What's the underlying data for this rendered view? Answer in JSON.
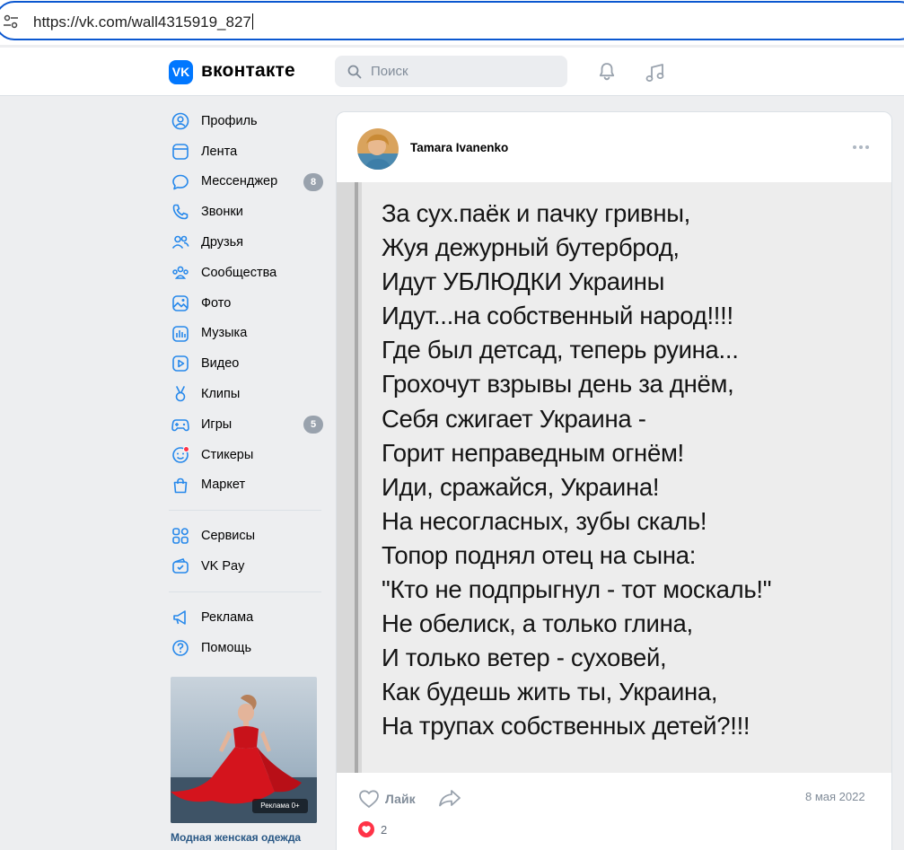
{
  "browser": {
    "url": "https://vk.com/wall4315919_827"
  },
  "header": {
    "logo_letters": "VK",
    "brand": "вконтакте",
    "search_placeholder": "Поиск"
  },
  "sidebar": {
    "items": [
      {
        "label": "Профиль",
        "icon": "profile-icon"
      },
      {
        "label": "Лента",
        "icon": "feed-icon"
      },
      {
        "label": "Мессенджер",
        "icon": "messenger-icon",
        "badge": "8"
      },
      {
        "label": "Звонки",
        "icon": "phone-icon"
      },
      {
        "label": "Друзья",
        "icon": "friends-icon"
      },
      {
        "label": "Сообщества",
        "icon": "communities-icon"
      },
      {
        "label": "Фото",
        "icon": "photo-icon"
      },
      {
        "label": "Музыка",
        "icon": "music-icon"
      },
      {
        "label": "Видео",
        "icon": "video-icon"
      },
      {
        "label": "Клипы",
        "icon": "clips-icon"
      },
      {
        "label": "Игры",
        "icon": "games-icon",
        "badge": "5"
      },
      {
        "label": "Стикеры",
        "icon": "stickers-icon"
      },
      {
        "label": "Маркет",
        "icon": "market-icon"
      }
    ],
    "items2": [
      {
        "label": "Сервисы",
        "icon": "services-icon"
      },
      {
        "label": "VK Pay",
        "icon": "vkpay-icon"
      }
    ],
    "items3": [
      {
        "label": "Реклама",
        "icon": "ads-icon"
      },
      {
        "label": "Помощь",
        "icon": "help-icon"
      }
    ],
    "ad": {
      "badge": "Реклама 0+",
      "title": "Модная женская одежда"
    }
  },
  "post": {
    "author": "Tamara Ivanenko",
    "poem": [
      "За сух.паёк и пачку гривны,",
      "Жуя дежурный бутерброд,",
      "Идут УБЛЮДКИ Украины",
      "Идут...на собственный народ!!!!",
      "Где был детсад, теперь руина...",
      "Грохочут взрывы день за днём,",
      "Себя сжигает Украина -",
      "Горит неправедным огнём!",
      "Иди, сражайся, Украина!",
      "На несогласных, зубы скаль!",
      "Топор поднял отец на сына:",
      "\"Кто не подпрыгнул - тот москаль!\"",
      "Не обелиск, а только глина,",
      "И только ветер - суховей,",
      "Как будешь жить ты, Украина,",
      "На трупах собственных детей?!!!"
    ],
    "like_label": "Лайк",
    "date": "8 мая 2022",
    "reactions_count": "2"
  },
  "colors": {
    "accent": "#0077ff",
    "link": "#2a5885",
    "muted": "#818c99",
    "badge": "#99a2ad",
    "heart": "#ff3347"
  }
}
